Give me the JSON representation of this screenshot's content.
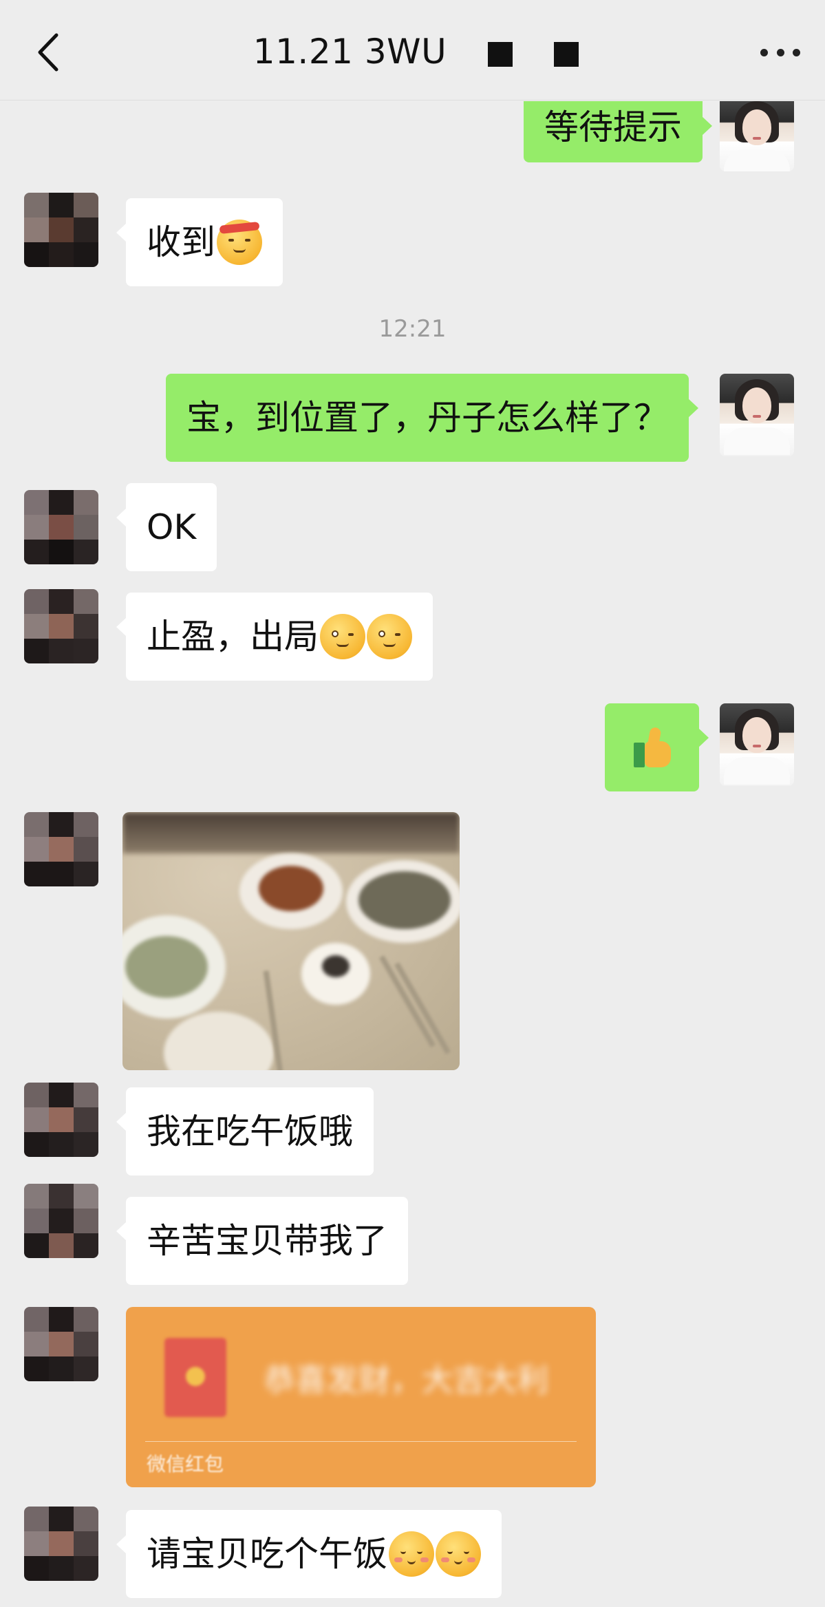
{
  "header": {
    "title": "11.21  3WU",
    "back_icon": "chevron-left-icon",
    "more_icon": "more-dots-icon"
  },
  "colors": {
    "background": "#ededed",
    "self_bubble": "#95ec69",
    "other_bubble": "#ffffff",
    "red_packet": "#f0a14b",
    "timestamp": "#9a9a9a"
  },
  "messages": {
    "m1": {
      "sender": "self",
      "text": "等待提示"
    },
    "m2": {
      "sender": "other",
      "text": "收到",
      "emoji": "salute-headband-emoji"
    },
    "timestamp": "12:21",
    "m3": {
      "sender": "self",
      "text": "宝，到位置了，丹子怎么样了？"
    },
    "m4": {
      "sender": "other",
      "text": "OK"
    },
    "m5": {
      "sender": "other",
      "text": "止盈，出局",
      "emoji": "wink-hand-emoji"
    },
    "m6": {
      "sender": "self",
      "emoji": "thumbs-up-icon"
    },
    "m7": {
      "sender": "other",
      "type": "image",
      "description": "food-photo"
    },
    "m8": {
      "sender": "other",
      "text": "我在吃午饭哦"
    },
    "m9": {
      "sender": "other",
      "text": "辛苦宝贝带我了"
    },
    "m10": {
      "sender": "other",
      "type": "red_packet",
      "text": "恭喜发财，大吉大利",
      "label": "微信红包"
    },
    "m11": {
      "sender": "other",
      "text": "请宝贝吃个午饭",
      "emoji": "shy-smile-emoji"
    }
  }
}
